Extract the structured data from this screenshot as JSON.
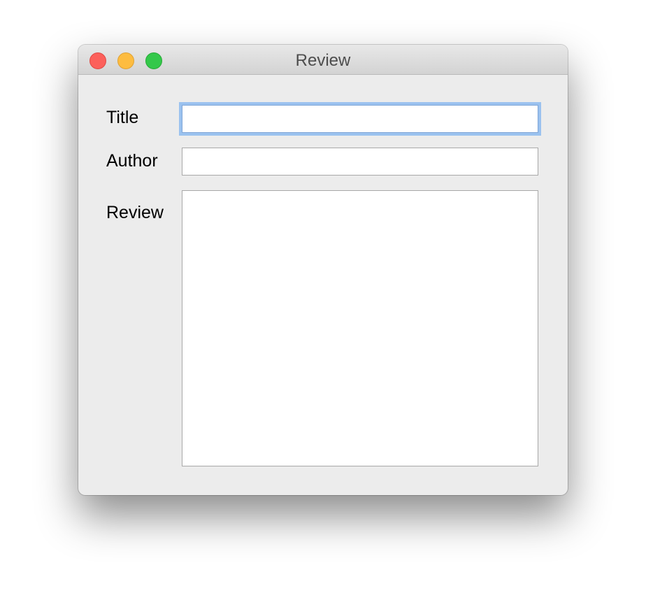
{
  "window": {
    "title": "Review"
  },
  "form": {
    "title_label": "Title",
    "title_value": "",
    "author_label": "Author",
    "author_value": "",
    "review_label": "Review",
    "review_value": ""
  },
  "colors": {
    "close": "#fc605b",
    "minimize": "#fdbc40",
    "zoom": "#34c84a",
    "focus_ring": "#9bc2ef"
  }
}
